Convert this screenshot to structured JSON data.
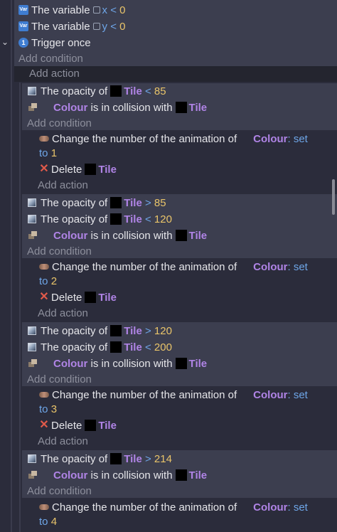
{
  "top": {
    "cond1": {
      "lead": "The variable",
      "var": "x",
      "op": "<",
      "val": "0"
    },
    "cond2": {
      "lead": "The variable",
      "var": "y",
      "op": "<",
      "val": "0"
    },
    "cond3": {
      "text": "Trigger once"
    },
    "add_condition": "Add condition",
    "add_action": "Add action"
  },
  "events": [
    {
      "c1": {
        "lead": "The opacity of",
        "obj": "Tile",
        "op": "<",
        "val": "85"
      },
      "coll": {
        "obj": "Colour",
        "mid": "is in collision with",
        "obj2": "Tile"
      },
      "add_condition": "Add condition",
      "act": {
        "lead": "Change the number of the animation of",
        "obj": "Colour",
        "colon": ":",
        "set": "set",
        "to": "to",
        "val": "1"
      },
      "del": {
        "lead": "Delete",
        "obj": "Tile"
      },
      "add_action": "Add action"
    },
    {
      "c1": {
        "lead": "The opacity of",
        "obj": "Tile",
        "op": ">",
        "val": "85"
      },
      "c2": {
        "lead": "The opacity of",
        "obj": "Tile",
        "op": "<",
        "val": "120"
      },
      "coll": {
        "obj": "Colour",
        "mid": "is in collision with",
        "obj2": "Tile"
      },
      "add_condition": "Add condition",
      "act": {
        "lead": "Change the number of the animation of",
        "obj": "Colour",
        "colon": ":",
        "set": "set",
        "to": "to",
        "val": "2"
      },
      "del": {
        "lead": "Delete",
        "obj": "Tile"
      },
      "add_action": "Add action"
    },
    {
      "c1": {
        "lead": "The opacity of",
        "obj": "Tile",
        "op": ">",
        "val": "120"
      },
      "c2": {
        "lead": "The opacity of",
        "obj": "Tile",
        "op": "<",
        "val": "200"
      },
      "coll": {
        "obj": "Colour",
        "mid": "is in collision with",
        "obj2": "Tile"
      },
      "add_condition": "Add condition",
      "act": {
        "lead": "Change the number of the animation of",
        "obj": "Colour",
        "colon": ":",
        "set": "set",
        "to": "to",
        "val": "3"
      },
      "del": {
        "lead": "Delete",
        "obj": "Tile"
      },
      "add_action": "Add action"
    },
    {
      "c1": {
        "lead": "The opacity of",
        "obj": "Tile",
        "op": ">",
        "val": "214"
      },
      "coll": {
        "obj": "Colour",
        "mid": "is in collision with",
        "obj2": "Tile"
      },
      "add_condition": "Add condition",
      "act": {
        "lead": "Change the number of the animation of",
        "obj": "Colour",
        "colon": ":",
        "set": "set",
        "to": "to",
        "val": "4"
      }
    }
  ],
  "icons": {
    "variable": "variable-icon",
    "trigger": "trigger-once-icon",
    "opacity": "opacity-icon",
    "collision": "collision-icon",
    "animation": "animation-icon",
    "delete": "delete-icon",
    "object": "object-thumbnail",
    "collapse": "chevron-down-icon"
  },
  "colors": {
    "background": "#2b2c3b",
    "condition_bg": "#3c3e4f",
    "object_name": "#b084e6",
    "value": "#e9c46a",
    "operator": "#6ea6e8",
    "delete_icon": "#e05a4a"
  }
}
